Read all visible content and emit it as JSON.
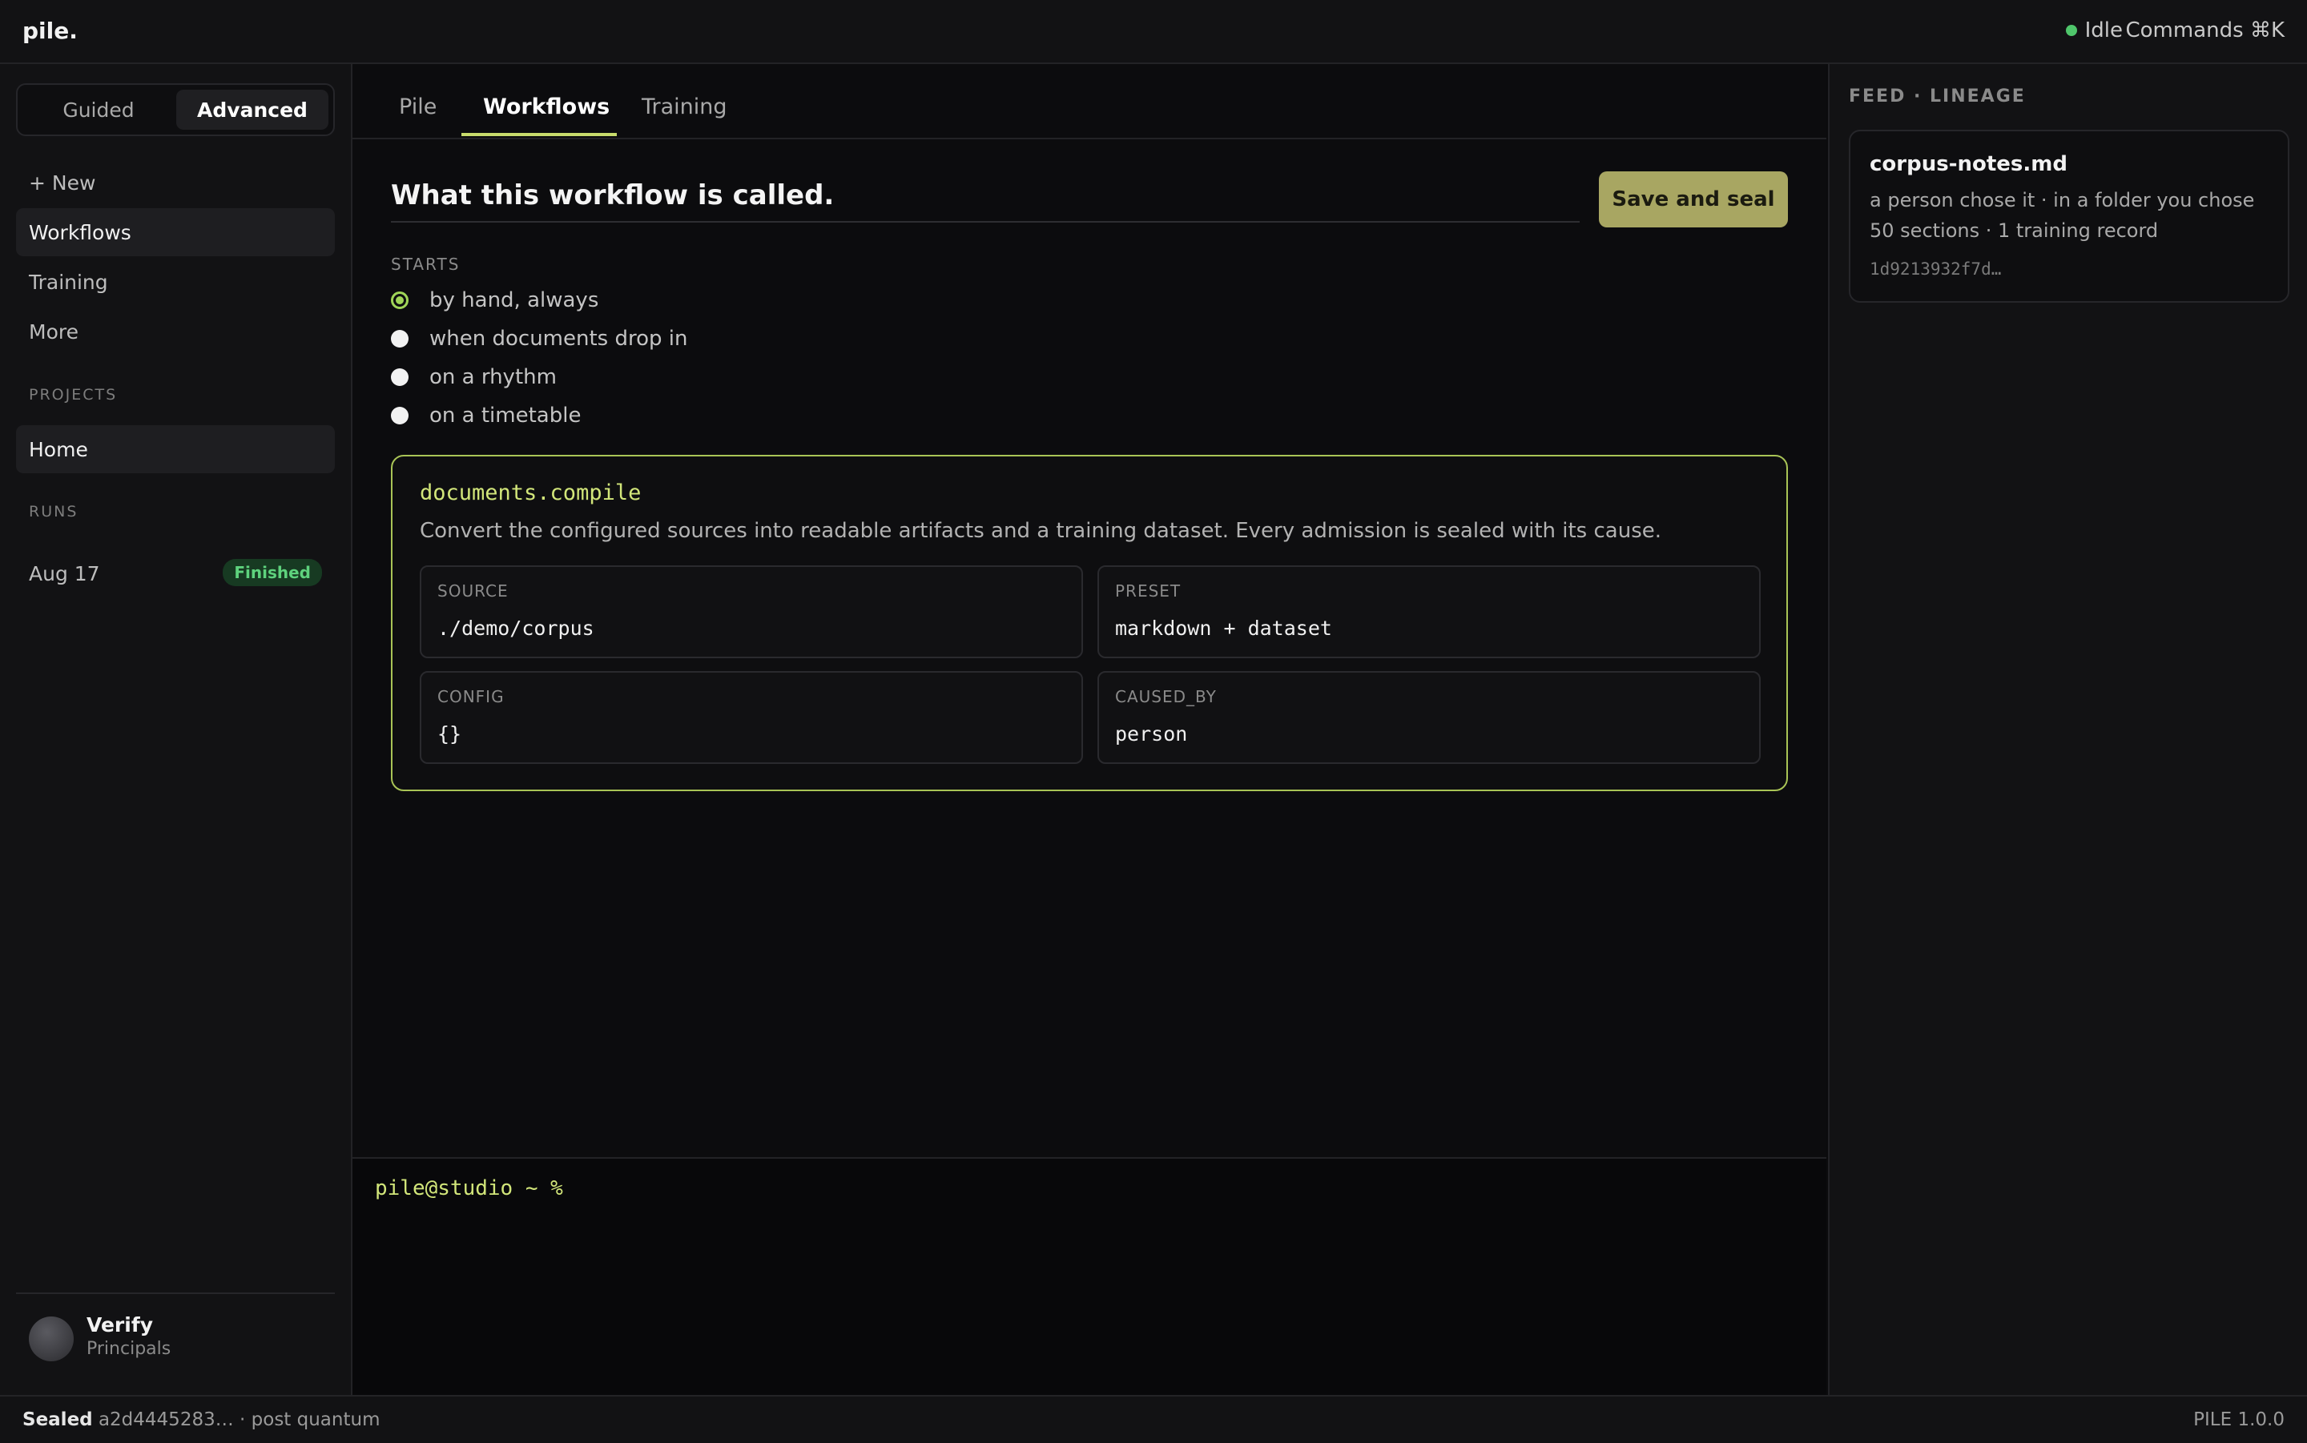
{
  "app": {
    "logo": "pile.",
    "status": "Idle",
    "commands": "Commands ⌘K"
  },
  "sidebar": {
    "mode": {
      "guided": "Guided",
      "advanced": "Advanced",
      "selected": "Advanced"
    },
    "items": [
      {
        "label": "+ New"
      },
      {
        "label": "Workflows",
        "active": true
      },
      {
        "label": "Training"
      },
      {
        "label": "More"
      }
    ],
    "projects_heading": "PROJECTS",
    "projects": [
      {
        "label": "Home"
      }
    ],
    "runs_heading": "RUNS",
    "runs": [
      {
        "label": "Aug 17",
        "badge": "Finished"
      }
    ],
    "user": {
      "name": "Verify",
      "role": "Principals"
    }
  },
  "main": {
    "tabs": [
      {
        "label": "Pile"
      },
      {
        "label": "Workflows",
        "active": true
      },
      {
        "label": "Training"
      }
    ],
    "workflow_title": "What this workflow is called.",
    "save_label": "Save and seal",
    "starts_heading": "STARTS",
    "starts": [
      {
        "label": "by hand, always",
        "selected": true
      },
      {
        "label": "when documents drop in"
      },
      {
        "label": "on a rhythm"
      },
      {
        "label": "on a timetable"
      }
    ],
    "step": {
      "name": "documents.compile",
      "description": "Convert the configured sources into readable artifacts and a training dataset. Every admission is sealed with its cause.",
      "fields": [
        {
          "label": "SOURCE",
          "value": "./demo/corpus"
        },
        {
          "label": "PRESET",
          "value": "markdown + dataset"
        },
        {
          "label": "CONFIG",
          "value": "{}"
        },
        {
          "label": "CAUSED_BY",
          "value": "person"
        }
      ]
    }
  },
  "terminal": {
    "prompt": "pile@studio ~ %"
  },
  "feed": {
    "heading": "FEED · LINEAGE",
    "cards": [
      {
        "name": "corpus-notes.md",
        "line1": "a person chose it · in a folder you chose",
        "line2": "50 sections · 1 training record",
        "hash": "1d9213932f7d…"
      }
    ]
  },
  "footer": {
    "sealed_label": "Sealed",
    "sealed_value": "a2d4445283… · post quantum",
    "version": "PILE 1.0.0"
  },
  "colors": {
    "accent": "#c8dc6c",
    "button": "#a8a662",
    "success": "#4fc66b"
  }
}
